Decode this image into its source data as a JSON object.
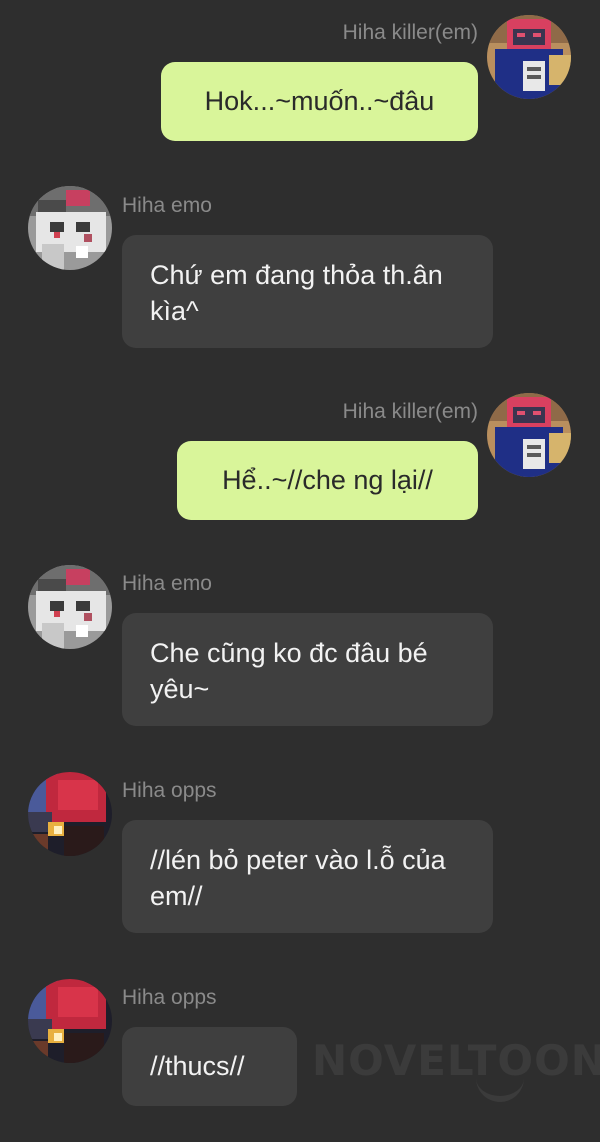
{
  "messages": [
    {
      "sender": "Hiha killer(em)",
      "text": "Hok...~muốn..~đâu",
      "own": true,
      "avatar": "avatar-killer"
    },
    {
      "sender": "Hiha emo",
      "text": "Chứ em đang thỏa th.ân kìa^",
      "own": false,
      "avatar": "avatar-emo"
    },
    {
      "sender": "Hiha killer(em)",
      "text": "Hể..~//che ng lại//",
      "own": true,
      "avatar": "avatar-killer"
    },
    {
      "sender": "Hiha emo",
      "text": "Che cũng ko đc đâu bé yêu~",
      "own": false,
      "avatar": "avatar-emo"
    },
    {
      "sender": "Hiha opps",
      "text": "//lén bỏ peter vào l.ỗ của em//",
      "own": false,
      "avatar": "avatar-opps"
    },
    {
      "sender": "Hiha opps",
      "text": "//thucs//",
      "own": false,
      "avatar": "avatar-opps"
    }
  ],
  "watermark": "NOVELTOON",
  "colors": {
    "background": "#2e2e2e",
    "own_bubble": "#d9f59a",
    "other_bubble": "#3f3f3f",
    "sender_text": "#8a8a8a"
  }
}
